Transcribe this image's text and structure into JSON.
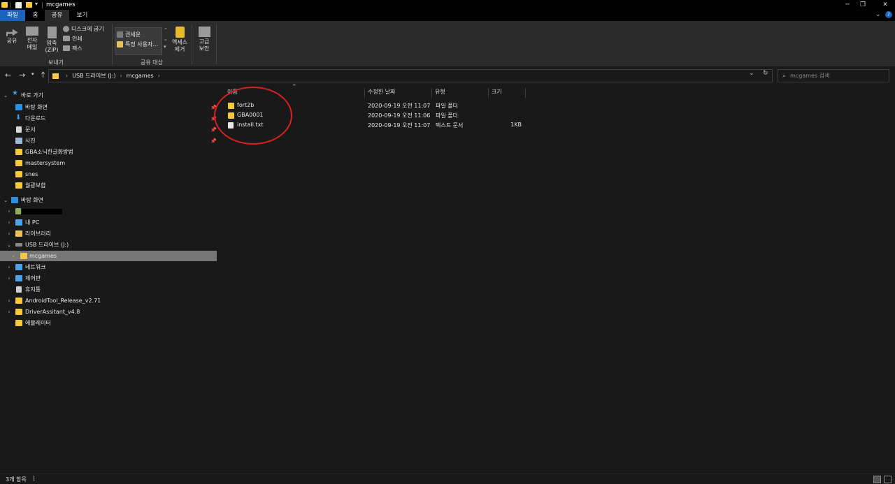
{
  "window": {
    "title": "mcgames",
    "minimize_glyph": "─",
    "restore_glyph": "❐",
    "close_glyph": "✕"
  },
  "ribbon_tabs": [
    {
      "label": "파일"
    },
    {
      "label": "홈"
    },
    {
      "label": "공유"
    },
    {
      "label": "보기"
    }
  ],
  "ribbon": {
    "share_label": "공유",
    "email_label_1": "전자",
    "email_label_2": "메일",
    "zip_label_1": "압축",
    "zip_label_2": "(ZIP)",
    "burn_label": "디스크에 굽기",
    "print_label": "인쇄",
    "fax_label": "팩스",
    "send_group": "보내기",
    "share_with_1": "권세운",
    "share_with_2": "특정 사용자...",
    "remove_access_1": "액세스",
    "remove_access_2": "제거",
    "share_group": "공유 대상",
    "advanced_1": "고급",
    "advanced_2": "보안"
  },
  "address": {
    "crumbs": [
      "USB 드라이브 (J:)",
      "mcgames"
    ],
    "search_placeholder": "mcgames 검색"
  },
  "sidebar": {
    "items": [
      {
        "label": "바로 가기",
        "icon": "star-icon",
        "color": "#3b9de0"
      },
      {
        "label": "바탕 화면",
        "icon": "desktop-icon",
        "color": "#2f8fe0"
      },
      {
        "label": "다운로드",
        "icon": "download-icon",
        "color": "#3b9de0"
      },
      {
        "label": "문서",
        "icon": "document-icon",
        "color": "#d8d8d8"
      },
      {
        "label": "사진",
        "icon": "pictures-icon",
        "color": "#9ab8d8"
      },
      {
        "label": "GBA소닉한글화방법",
        "icon": "folder-icon",
        "color": "#f5c842"
      },
      {
        "label": "mastersystem",
        "icon": "folder-icon",
        "color": "#f5c842"
      },
      {
        "label": "snes",
        "icon": "folder-icon",
        "color": "#f5c842"
      },
      {
        "label": "월광보합",
        "icon": "folder-icon",
        "color": "#f5c842"
      },
      {
        "label": "바탕 화면",
        "icon": "desktop-icon",
        "color": "#2f8fe0"
      },
      {
        "label": "",
        "icon": "user-icon",
        "color": "#8fb05a"
      },
      {
        "label": "내 PC",
        "icon": "pc-icon",
        "color": "#4aa3e8"
      },
      {
        "label": "라이브러리",
        "icon": "library-icon",
        "color": "#e8c15a"
      },
      {
        "label": "USB 드라이브 (J:)",
        "icon": "usb-drive-icon",
        "color": "#8a8a8a"
      },
      {
        "label": "mcgames",
        "icon": "folder-icon",
        "color": "#f5c842"
      },
      {
        "label": "네트워크",
        "icon": "network-icon",
        "color": "#4aa3e8"
      },
      {
        "label": "제어판",
        "icon": "control-panel-icon",
        "color": "#4aa3e8"
      },
      {
        "label": "휴지통",
        "icon": "recycle-bin-icon",
        "color": "#cfcfcf"
      },
      {
        "label": "AndroidTool_Release_v2.71",
        "icon": "folder-icon",
        "color": "#f5c842"
      },
      {
        "label": "DriverAssitant_v4.8",
        "icon": "folder-icon",
        "color": "#f5c842"
      },
      {
        "label": "에뮬레이터",
        "icon": "folder-icon",
        "color": "#f5c842"
      }
    ]
  },
  "columns": {
    "name": "이름",
    "modified": "수정한 날짜",
    "type": "유형",
    "size": "크기"
  },
  "files": [
    {
      "name": "fort2b",
      "modified": "2020-09-19 오전 11:07",
      "type": "파일 폴더",
      "size": "",
      "icon": "folder-icon",
      "color": "#f5c842"
    },
    {
      "name": "GBA0001",
      "modified": "2020-09-19 오전 11:06",
      "type": "파일 폴더",
      "size": "",
      "icon": "folder-icon",
      "color": "#f5c842"
    },
    {
      "name": "install.txt",
      "modified": "2020-09-19 오전 11:07",
      "type": "텍스트 문서",
      "size": "1KB",
      "icon": "text-file-icon",
      "color": "#e8e8e8"
    }
  ],
  "status": {
    "item_count": "3개 항목"
  }
}
